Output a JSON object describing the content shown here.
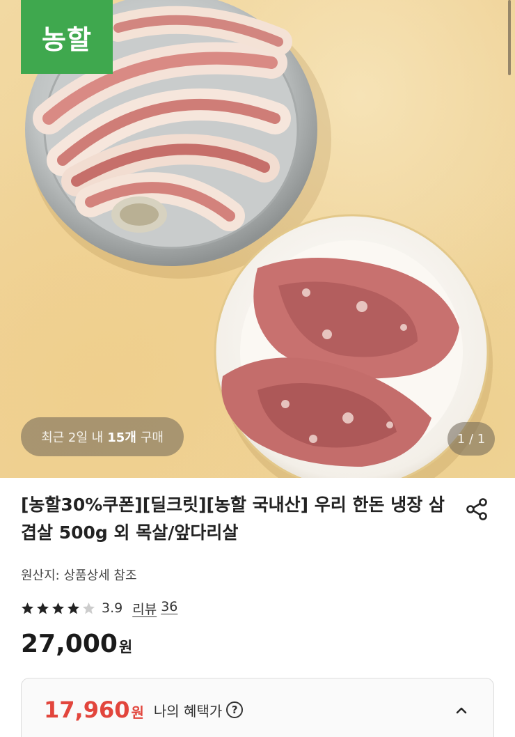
{
  "hero": {
    "brand_logo": "농할",
    "purchase_badge": {
      "prefix": "최근 2일 내",
      "count": "15개",
      "suffix": "구매"
    },
    "image_counter": "1 / 1"
  },
  "product": {
    "title": "[농할30%쿠폰][딜크릿][농할 국내산] 우리 한돈 냉장 삼겹살 500g 외 목살/앞다리살",
    "origin": "원산지: 상품상세 참조",
    "rating": {
      "stars_filled": 4,
      "stars_total": 5,
      "value": "3.9",
      "review_label": "리뷰",
      "review_count": "36"
    },
    "price": {
      "amount": "27,000",
      "unit": "원"
    }
  },
  "benefit": {
    "amount": "17,960",
    "unit": "원",
    "label": "나의 혜택가",
    "help_icon": "question-circle-icon",
    "collapse_icon": "chevron-up-icon"
  },
  "icons": {
    "share": "share-icon",
    "star": "star-icon"
  },
  "colors": {
    "brand_green": "#3fa84e",
    "benefit_red": "#e2453c",
    "star_filled": "#222222",
    "star_empty": "#cccccc"
  }
}
